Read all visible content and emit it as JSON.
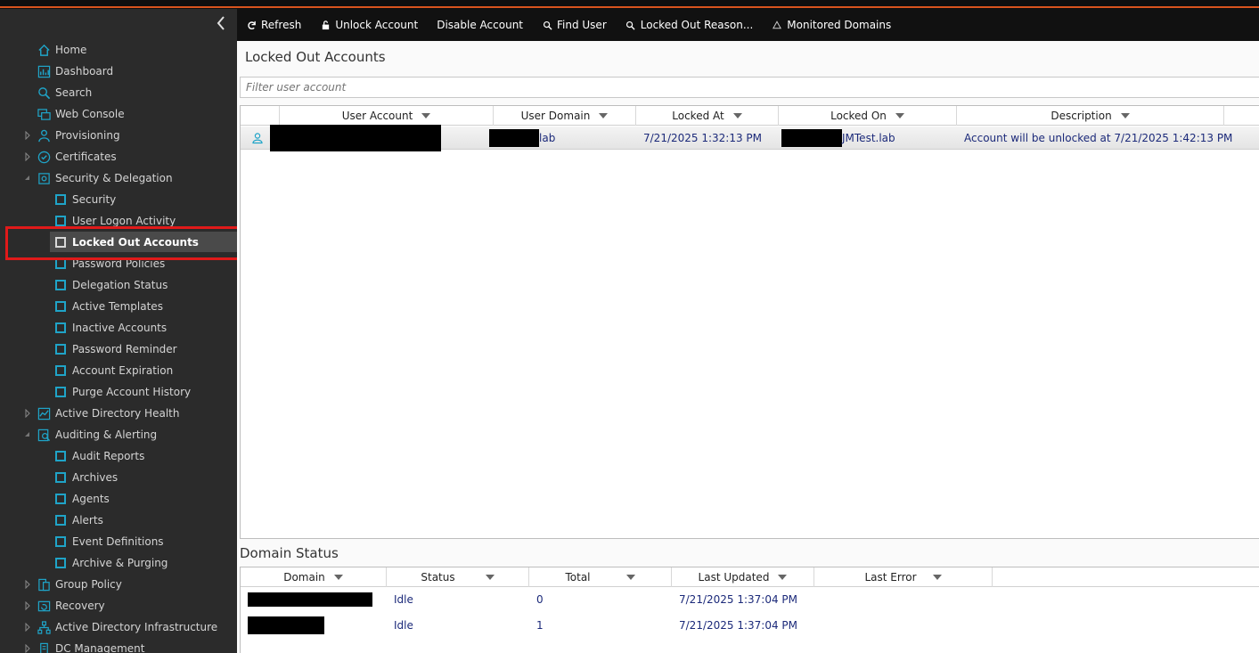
{
  "sidebar": {
    "items": [
      {
        "label": "Home",
        "icon": "home-icon"
      },
      {
        "label": "Dashboard",
        "icon": "dashboard-icon"
      },
      {
        "label": "Search",
        "icon": "search-icon"
      },
      {
        "label": "Web Console",
        "icon": "web-console-icon"
      },
      {
        "label": "Provisioning",
        "icon": "provisioning-icon"
      },
      {
        "label": "Certificates",
        "icon": "certificates-icon"
      },
      {
        "label": "Security & Delegation",
        "icon": "security-delegation-icon"
      },
      {
        "label": "Security"
      },
      {
        "label": "User Logon Activity"
      },
      {
        "label": "Locked Out Accounts"
      },
      {
        "label": "Password Policies"
      },
      {
        "label": "Delegation Status"
      },
      {
        "label": "Active Templates"
      },
      {
        "label": "Inactive Accounts"
      },
      {
        "label": "Password Reminder"
      },
      {
        "label": "Account Expiration"
      },
      {
        "label": "Purge Account History"
      },
      {
        "label": "Active Directory Health",
        "icon": "ad-health-icon"
      },
      {
        "label": "Auditing & Alerting",
        "icon": "auditing-icon"
      },
      {
        "label": "Audit Reports"
      },
      {
        "label": "Archives"
      },
      {
        "label": "Agents"
      },
      {
        "label": "Alerts"
      },
      {
        "label": "Event Definitions"
      },
      {
        "label": "Archive & Purging"
      },
      {
        "label": "Group Policy",
        "icon": "group-policy-icon"
      },
      {
        "label": "Recovery",
        "icon": "recovery-icon"
      },
      {
        "label": "Active Directory Infrastructure",
        "icon": "ad-infrastructure-icon"
      },
      {
        "label": "DC Management",
        "icon": "dc-management-icon"
      }
    ],
    "selected": "Locked Out Accounts"
  },
  "toolbar": {
    "refresh": "Refresh",
    "unlock": "Unlock Account",
    "disable": "Disable Account",
    "find": "Find User",
    "reason": "Locked Out Reason...",
    "monitored": "Monitored Domains"
  },
  "main": {
    "title": "Locked Out Accounts",
    "filter_placeholder": "Filter user account",
    "columns": [
      "User Account",
      "User Domain",
      "Locked At",
      "Locked On",
      "Description"
    ],
    "rows": [
      {
        "user_domain_suffix": "lab",
        "locked_at": "7/21/2025 1:32:13 PM",
        "locked_on_suffix": "JMTest.lab",
        "description": "Account will be unlocked at 7/21/2025 1:42:13 PM"
      }
    ]
  },
  "domain_status": {
    "title": "Domain Status",
    "columns": [
      "Domain",
      "Status",
      "Total",
      "Last Updated",
      "Last Error"
    ],
    "rows": [
      {
        "status": "Idle",
        "total": "0",
        "last_updated": "7/21/2025 1:37:04 PM"
      },
      {
        "status": "Idle",
        "total": "1",
        "last_updated": "7/21/2025 1:37:04 PM"
      }
    ]
  },
  "colors": {
    "accent": "#d9541e",
    "sidebar_bg": "#2b2b2b",
    "toolbar_bg": "#111111",
    "icon_teal": "#1fa4c8",
    "value_text": "#1c2a7a",
    "highlight": "#e01a1a"
  }
}
